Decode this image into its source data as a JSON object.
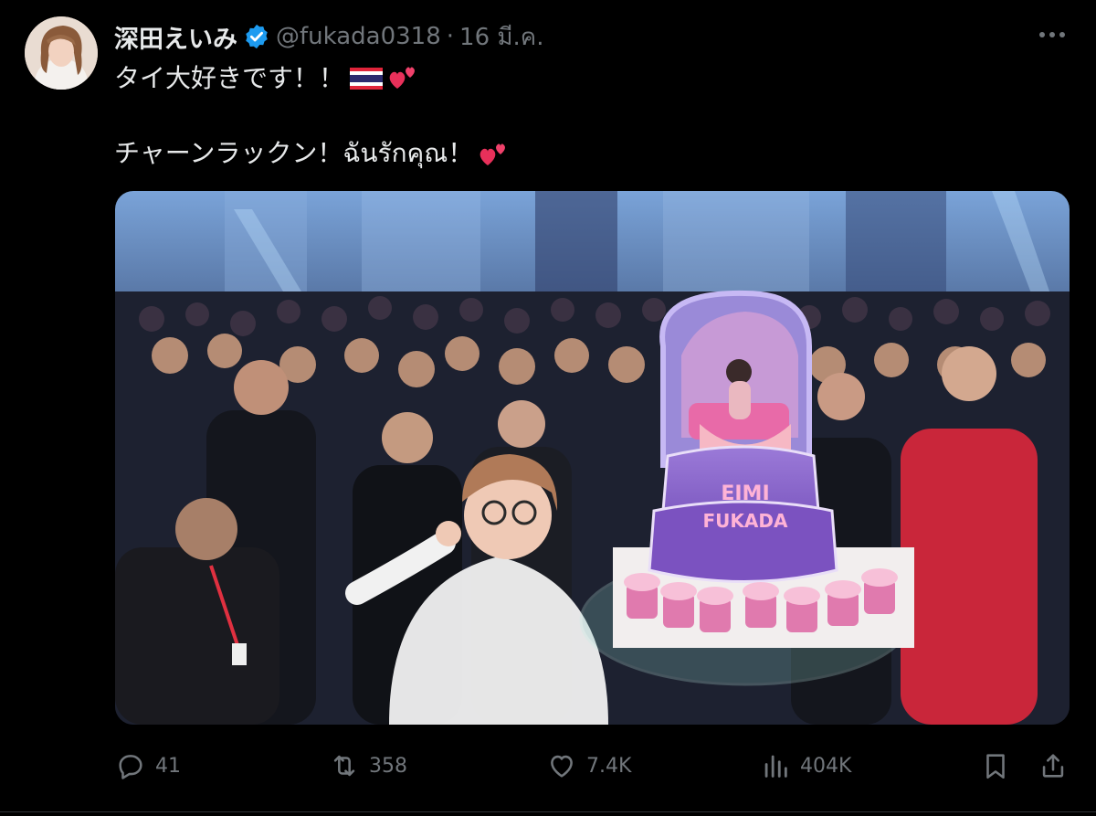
{
  "post": {
    "author": {
      "display_name": "深田えいみ",
      "handle": "@fukada0318",
      "verified": true
    },
    "separator": "·",
    "date": "16 มี.ค.",
    "more_icon": "more-horizontal-icon",
    "text_line1": "タイ大好きです！！",
    "text_line2": "チャーンラックン！ฉันรักคุณ！",
    "emoji": {
      "flag": "thailand-flag-icon",
      "hearts": "two-hearts-icon"
    },
    "media": {
      "cake_text_line1": "EIMI",
      "cake_text_line2": "FUKADA"
    }
  },
  "actions": {
    "replies": "41",
    "reposts": "358",
    "likes": "7.4K",
    "views": "404K"
  },
  "colors": {
    "background": "#000000",
    "text": "#e7e9ea",
    "muted": "#71767b",
    "verified": "#1d9bf0"
  }
}
